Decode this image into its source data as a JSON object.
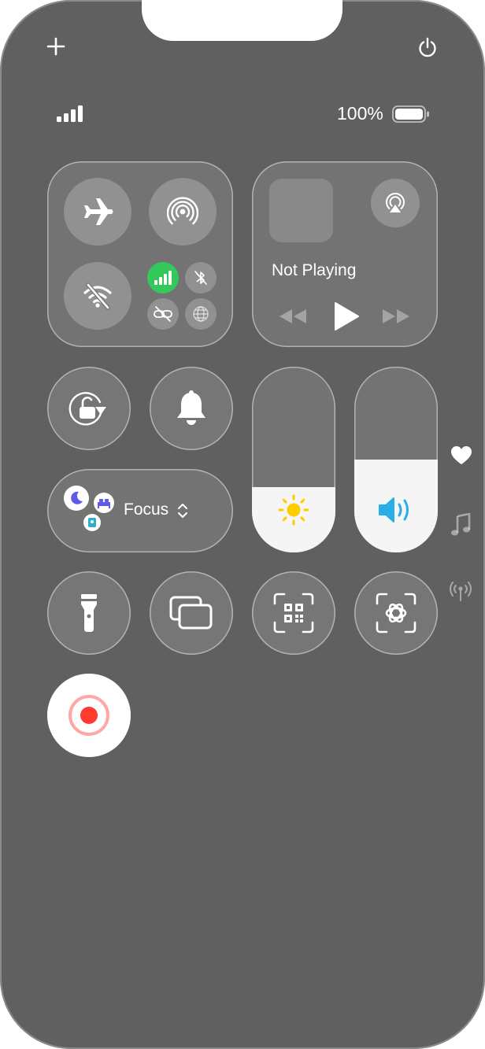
{
  "status": {
    "battery": "100%",
    "signal_bars": 4
  },
  "top": {
    "add_icon": "plus-icon",
    "power_icon": "power-icon"
  },
  "connectivity": {
    "airplane": {
      "icon": "airplane-icon",
      "on": false
    },
    "airdrop": {
      "icon": "airdrop-icon",
      "on": false
    },
    "wifi": {
      "icon": "wifi-off-icon",
      "on": false
    },
    "cellular": {
      "icon": "cellular-icon",
      "on": true,
      "color": "#34c759"
    },
    "bluetooth": {
      "icon": "bluetooth-off-icon",
      "on": false
    },
    "hotspot": {
      "icon": "link-off-icon",
      "on": false
    },
    "vpn": {
      "icon": "globe-icon",
      "on": false
    }
  },
  "media": {
    "status": "Not Playing",
    "airplay_icon": "airplay-icon"
  },
  "controls": {
    "orientation_lock_icon": "rotation-lock-icon",
    "silent_icon": "bell-icon",
    "focus_label": "Focus",
    "brightness_level": 0.35,
    "volume_level": 0.5,
    "flashlight_icon": "flashlight-icon",
    "screen_mirroring_icon": "screen-mirroring-icon",
    "code_scanner_icon": "qr-scanner-icon",
    "recognize_icon": "visual-lookup-icon",
    "record_icon": "screen-record-icon"
  },
  "page_dots": [
    "heart-icon",
    "music-icon",
    "antenna-icon"
  ],
  "colors": {
    "accent_green": "#34c759",
    "sun": "#ffcc00",
    "volume_blue": "#2aaee6",
    "focus_purple": "#5e5ce6",
    "focus_teal": "#30b0c7",
    "record_red": "#ff3b30"
  }
}
